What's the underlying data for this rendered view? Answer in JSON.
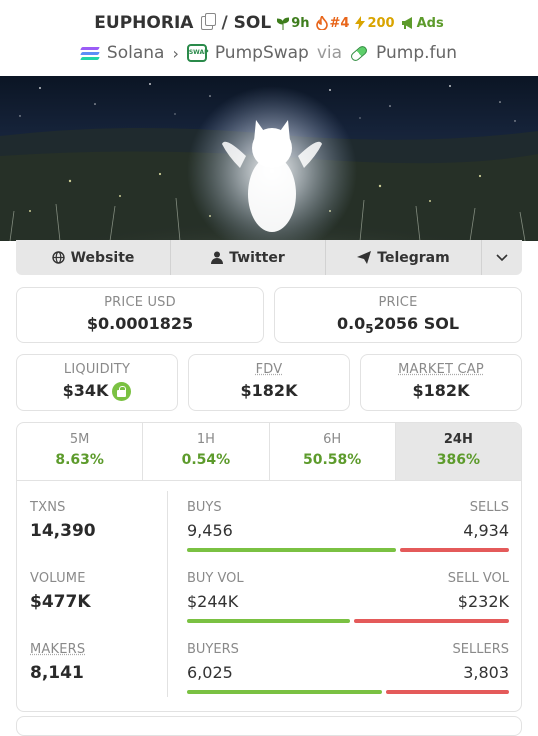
{
  "header": {
    "token": "EUPHORIA",
    "separator": "/",
    "quote": "SOL",
    "age": "9h",
    "rank": "#4",
    "boosts": "200",
    "ads": "Ads",
    "chain": "Solana",
    "dex": "PumpSwap",
    "via": "via",
    "launchpad": "Pump.fun"
  },
  "links": {
    "website": "Website",
    "twitter": "Twitter",
    "telegram": "Telegram"
  },
  "prices": {
    "price_usd_label": "PRICE USD",
    "price_usd": "$0.0001825",
    "price_label": "PRICE",
    "price_sol_prefix": "0.0",
    "price_sol_sub": "5",
    "price_sol_suffix": "2056 SOL"
  },
  "metrics": {
    "liquidity_label": "LIQUIDITY",
    "liquidity": "$34K",
    "fdv_label": "FDV",
    "fdv": "$182K",
    "mcap_label": "MARKET CAP",
    "mcap": "$182K"
  },
  "timeframes": [
    {
      "label": "5M",
      "change": "8.63%"
    },
    {
      "label": "1H",
      "change": "0.54%"
    },
    {
      "label": "6H",
      "change": "50.58%"
    },
    {
      "label": "24H",
      "change": "386%"
    }
  ],
  "txns": {
    "txns_label": "TXNS",
    "txns": "14,390",
    "buys_label": "BUYS",
    "buys": "9,456",
    "sells_label": "SELLS",
    "sells": "4,934",
    "buy_ratio": 0.657
  },
  "volume": {
    "volume_label": "VOLUME",
    "volume": "$477K",
    "buy_vol_label": "BUY VOL",
    "buy_vol": "$244K",
    "sell_vol_label": "SELL VOL",
    "sell_vol": "$232K",
    "buy_ratio": 0.513
  },
  "makers": {
    "makers_label": "MAKERS",
    "makers": "8,141",
    "buyers_label": "BUYERS",
    "buyers": "6,025",
    "sellers_label": "SELLERS",
    "sellers": "3,803",
    "buy_ratio": 0.613
  },
  "colors": {
    "positive": "#5d9b2c",
    "buy_bar": "#7ac142",
    "sell_bar": "#e45a5a",
    "rank": "#e8651a",
    "boost": "#d9a400"
  }
}
